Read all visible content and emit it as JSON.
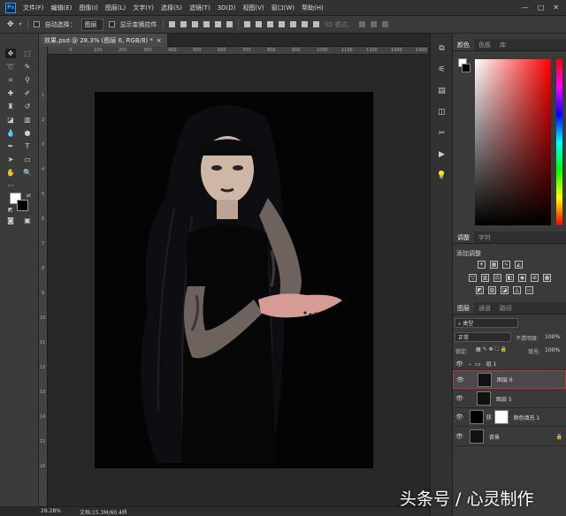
{
  "app": {
    "logo": "Ps"
  },
  "menu": [
    "文件(F)",
    "编辑(E)",
    "图像(I)",
    "图层(L)",
    "文字(Y)",
    "选择(S)",
    "滤镜(T)",
    "3D(D)",
    "视图(V)",
    "窗口(W)",
    "帮助(H)"
  ],
  "window_buttons": [
    "—",
    "□",
    "✕"
  ],
  "options": {
    "auto_select_label": "自动选择：",
    "auto_select_value": "图层",
    "show_transform_label": "显示变换控件",
    "mode_3d_label": "3D 模式："
  },
  "document": {
    "tab_title": "效果.psd @ 28.3% (图层 6, RGB/8) *",
    "tab_close": "×",
    "ruler_numbers": [
      "0",
      "100",
      "200",
      "300",
      "400",
      "500",
      "600",
      "700",
      "800",
      "900",
      "1000",
      "1100",
      "1200",
      "1300",
      "1400"
    ],
    "vruler_numbers": [
      "1",
      "2",
      "3",
      "4",
      "5",
      "6",
      "7",
      "8",
      "9",
      "10",
      "11",
      "12",
      "13",
      "14",
      "15",
      "16"
    ]
  },
  "status": {
    "zoom": "28.28%",
    "doc_info": "文档:15.3M/60.4M",
    "arrow": "›"
  },
  "color_panel": {
    "tabs": [
      "颜色",
      "色板",
      "库"
    ],
    "fg_color": "#ffffff",
    "bg_color": "#000000"
  },
  "adjustments_panel": {
    "tabs": [
      "调整",
      "字符"
    ],
    "title": "添加调整",
    "row1_icons": [
      "brightness-contrast-icon",
      "levels-icon",
      "curves-icon",
      "exposure-icon"
    ],
    "row2_icons": [
      "vibrance-icon",
      "hue-saturation-icon",
      "color-balance-icon",
      "black-white-icon",
      "photo-filter-icon",
      "channel-mixer-icon",
      "color-lookup-icon"
    ],
    "row3_icons": [
      "invert-icon",
      "posterize-icon",
      "threshold-icon",
      "selective-color-icon",
      "gradient-map-icon"
    ]
  },
  "layers_panel": {
    "tabs": [
      "图层",
      "通道",
      "路径"
    ],
    "filter_label": "类型",
    "blend_mode": "正常",
    "opacity_label": "不透明度:",
    "opacity_value": "100%",
    "lock_label": "锁定:",
    "fill_label": "填充:",
    "fill_value": "100%",
    "layers": [
      {
        "name": "组 1",
        "type": "group"
      },
      {
        "name": "图层 6",
        "type": "pixel",
        "selected": true
      },
      {
        "name": "图层 5",
        "type": "pixel"
      },
      {
        "name": "颜色填充 1",
        "type": "fill"
      },
      {
        "name": "背景",
        "type": "background"
      }
    ]
  },
  "watermark": "头条号 / 心灵制作"
}
